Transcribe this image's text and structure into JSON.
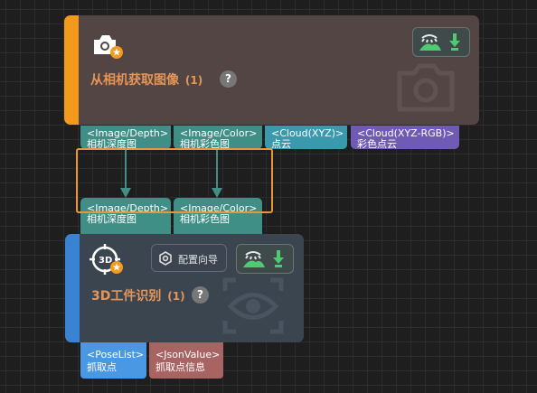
{
  "nodes": [
    {
      "title": "从相机获取图像",
      "count": "(1)",
      "help": "?",
      "icon": "camera-icon",
      "outputs": [
        {
          "type": "<Image/Depth>",
          "label": "相机深度图",
          "color": "#3f8f86"
        },
        {
          "type": "<Image/Color>",
          "label": "相机彩色图",
          "color": "#3f8f86"
        },
        {
          "type": "<Cloud(XYZ)>",
          "label": "点云",
          "color": "#3b99ad"
        },
        {
          "type": "<Cloud(XYZ-RGB)>",
          "label": "彩色点云",
          "color": "#6f5ab4"
        }
      ]
    },
    {
      "title": "3D工件识别",
      "count": "(1)",
      "help": "?",
      "icon": "3d-target-icon",
      "button": "配置向导",
      "inputs": [
        {
          "type": "<Image/Depth>",
          "label": "相机深度图",
          "color": "#3f8f86"
        },
        {
          "type": "<Image/Color>",
          "label": "相机彩色图",
          "color": "#3f8f86"
        }
      ],
      "outputs": [
        {
          "type": "<PoseList>",
          "label": "抓取点",
          "color": "#4a98e3"
        },
        {
          "type": "<JsonValue>",
          "label": "抓取点信息",
          "color": "#a86462"
        }
      ]
    }
  ],
  "colors": {
    "accent_orange": "#f39a1d",
    "accent_blue": "#3a82d2",
    "selection": "#e89540",
    "title": "#e59556"
  }
}
